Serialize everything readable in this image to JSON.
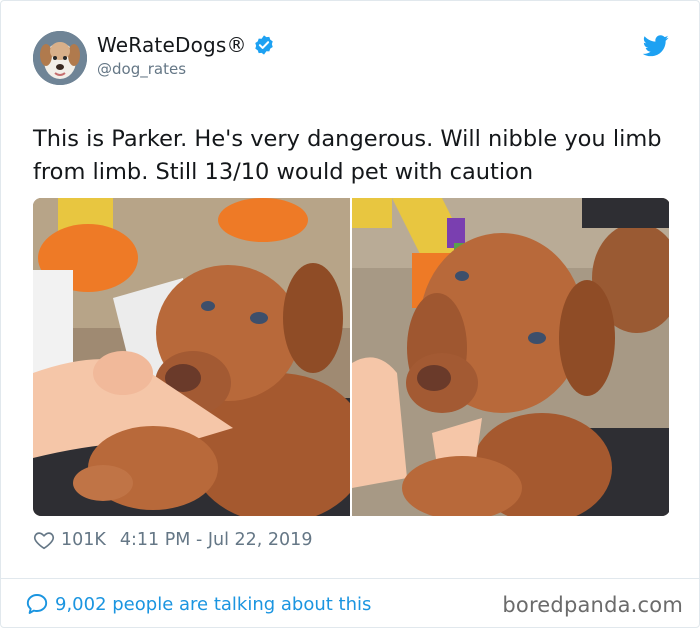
{
  "account": {
    "name": "WeRateDogs®",
    "handle": "@dog_rates",
    "verified_icon": "verified-badge-icon",
    "platform_icon": "twitter-bird-icon"
  },
  "tweet": {
    "text": "This is Parker. He's very dangerous. Will nibble you limb from limb. Still 13/10 would pet with caution",
    "photos": [
      {
        "alt": "puppy nibbling a finger"
      },
      {
        "alt": "puppy holding a finger"
      }
    ]
  },
  "meta": {
    "likes": "101K",
    "timestamp": "4:11 PM - Jul 22, 2019",
    "like_icon": "heart-icon"
  },
  "footer": {
    "talking": "9,002 people are talking about this",
    "talking_icon": "speech-bubble-icon"
  },
  "watermark": "boredpanda.com",
  "colors": {
    "accent": "#1da1f2",
    "link": "#1b95e0",
    "muted": "#657786",
    "text": "#14171a"
  }
}
